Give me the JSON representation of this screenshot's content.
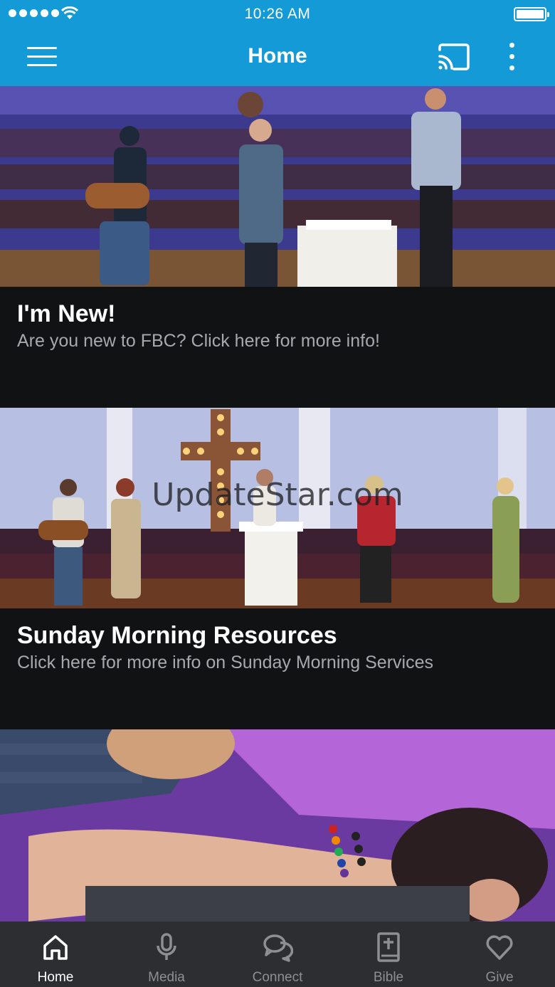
{
  "status_bar": {
    "time": "10:26 AM",
    "signal_icon": "signal-dots-icon",
    "wifi_icon": "wifi-icon",
    "battery_icon": "battery-icon",
    "battery_level": 1.0
  },
  "header": {
    "title": "Home",
    "menu_icon": "hamburger-menu-icon",
    "cast_icon": "cast-icon",
    "more_icon": "more-vertical-icon",
    "background_color": "#149ad6"
  },
  "feed": {
    "items": [
      {
        "title": "I'm New!",
        "subtitle": "Are you new to FBC? Click here for more info!",
        "image": "worship-band-stage-photo"
      },
      {
        "title": "Sunday Morning Resources",
        "subtitle": "Click here for more info on Sunday Morning Services",
        "image": "stage-with-cross-photo"
      },
      {
        "image": "prayer-hand-on-shoulder-photo"
      }
    ]
  },
  "watermark": "UpdateStar.com",
  "tab_bar": {
    "active_index": 0,
    "tabs": [
      {
        "label": "Home",
        "icon": "home-icon"
      },
      {
        "label": "Media",
        "icon": "microphone-icon"
      },
      {
        "label": "Connect",
        "icon": "chat-bubbles-icon"
      },
      {
        "label": "Bible",
        "icon": "bible-icon"
      },
      {
        "label": "Give",
        "icon": "heart-icon"
      }
    ]
  }
}
